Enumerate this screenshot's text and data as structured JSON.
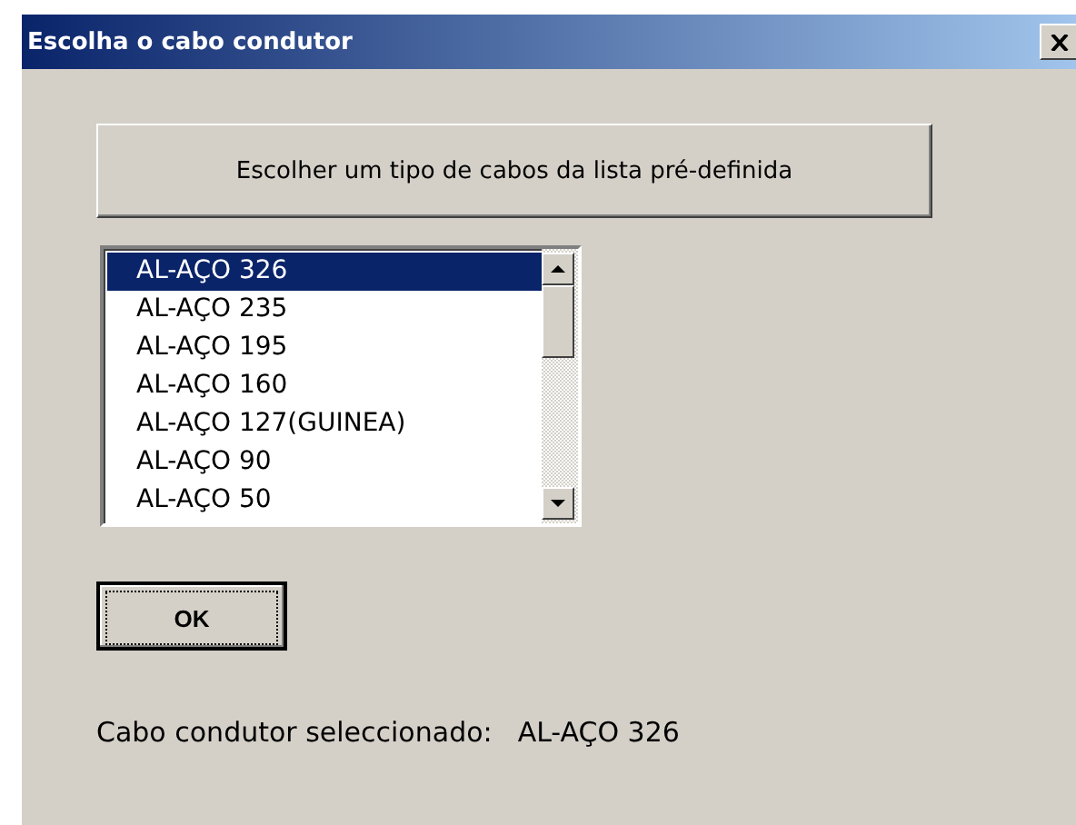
{
  "window": {
    "title": "Escolha o cabo condutor"
  },
  "choose_button": {
    "label": "Escolher um tipo de cabos da lista pré-definida"
  },
  "cable_list": {
    "items": [
      {
        "label": "AL-AÇO 326",
        "selected": true
      },
      {
        "label": "AL-AÇO 235",
        "selected": false
      },
      {
        "label": "AL-AÇO 195",
        "selected": false
      },
      {
        "label": "AL-AÇO 160",
        "selected": false
      },
      {
        "label": "AL-AÇO 127(GUINEA)",
        "selected": false
      },
      {
        "label": "AL-AÇO 90",
        "selected": false
      },
      {
        "label": "AL-AÇO 50",
        "selected": false
      }
    ]
  },
  "ok_button": {
    "label": "OK",
    "focused": true
  },
  "selection": {
    "label": "Cabo condutor seleccionado:",
    "value": "AL-AÇO 326"
  }
}
